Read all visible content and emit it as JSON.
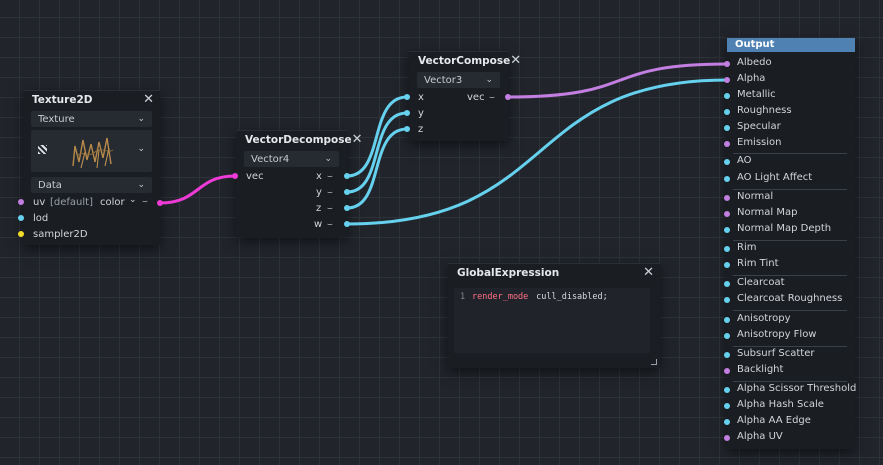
{
  "colors": {
    "cyan": "#66d1ee",
    "purple": "#c27ee0",
    "magenta": "#ee3ad6",
    "yellow": "#f2dd2a",
    "output_header": "#4f82b2"
  },
  "texture2d": {
    "title": "Texture2D",
    "source_dropdown": "Texture",
    "type_dropdown": "Data",
    "uv_label": "uv",
    "uv_default": "[default]",
    "color_label": "color",
    "lod_label": "lod",
    "sampler_label": "sampler2D"
  },
  "vector_decompose": {
    "title": "VectorDecompose",
    "type_dropdown": "Vector4",
    "input_label": "vec",
    "outputs": [
      "x",
      "y",
      "z",
      "w"
    ]
  },
  "vector_compose": {
    "title": "VectorCompose",
    "type_dropdown": "Vector3",
    "inputs": [
      "x",
      "y",
      "z"
    ],
    "output_label": "vec"
  },
  "global_expression": {
    "title": "GlobalExpression",
    "line_number": "1",
    "code_keyword": "render_mode",
    "code_rest": " cull_disabled;"
  },
  "output": {
    "title": "Output",
    "items": [
      "Albedo",
      "Alpha",
      "Metallic",
      "Roughness",
      "Specular",
      "Emission",
      "AO",
      "AO Light Affect",
      "Normal",
      "Normal Map",
      "Normal Map Depth",
      "Rim",
      "Rim Tint",
      "Clearcoat",
      "Clearcoat Roughness",
      "Anisotropy",
      "Anisotropy Flow",
      "Subsurf Scatter",
      "Backlight",
      "Alpha Scissor Threshold",
      "Alpha Hash Scale",
      "Alpha AA Edge",
      "Alpha UV"
    ]
  }
}
